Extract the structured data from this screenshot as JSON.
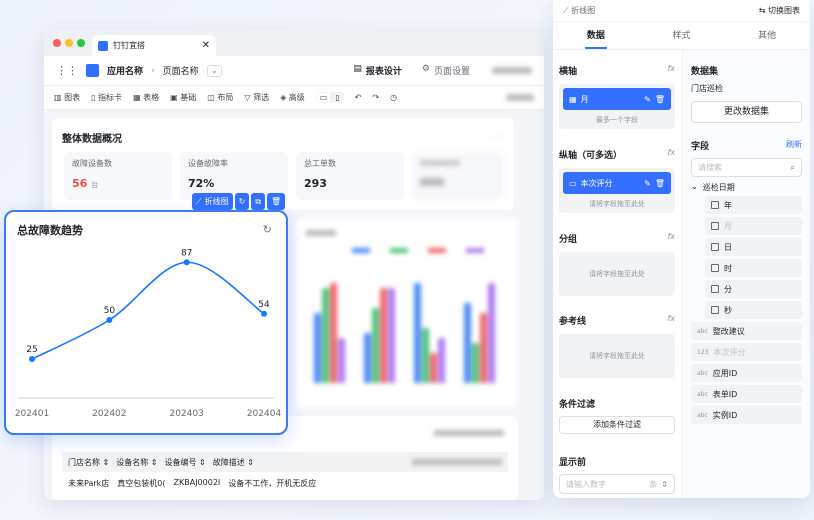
{
  "browser_tab": {
    "title": "钉钉宜搭"
  },
  "header": {
    "app_name": "应用名称",
    "page_name": "页面名称",
    "design_tab": "报表设计",
    "page_settings": "页面设置"
  },
  "toolbar": [
    "图表",
    "指标卡",
    "表格",
    "基础",
    "布局",
    "筛选",
    "高级"
  ],
  "overview": {
    "title": "整体数据概况",
    "stats": [
      {
        "label": "故障设备数",
        "value": "56",
        "unit": "台"
      },
      {
        "label": "设备故障率",
        "value": "72%"
      },
      {
        "label": "总工单数",
        "value": "293"
      }
    ]
  },
  "chart_toolbar": {
    "label": "折线图"
  },
  "chart_data": {
    "type": "line",
    "title": "总故障数趋势",
    "x": [
      "202401",
      "202402",
      "202403",
      "202404"
    ],
    "series": [
      {
        "values": [
          25,
          50,
          87,
          54
        ]
      }
    ],
    "ylim": [
      0,
      100
    ],
    "smooth": true,
    "grid": false,
    "colors": {
      "line": "#1677ff"
    }
  },
  "table": {
    "headers": [
      "门店名称",
      "设备名称",
      "设备编号",
      "故障描述"
    ],
    "row": [
      "未来Park店",
      "真空包装机0(",
      "ZKBAJ0002I",
      "设备不工作，开机无反应"
    ]
  },
  "panel": {
    "chart_type": "折线图",
    "switch_chart": "切换图表",
    "tabs": [
      "数据",
      "样式",
      "其他"
    ],
    "x_axis": {
      "title": "横轴",
      "chip": "月",
      "hint": "最多一个字段"
    },
    "y_axis": {
      "title": "纵轴（可多选）",
      "chip": "本次评分",
      "hint": "请将字段拖至此处"
    },
    "group": {
      "title": "分组",
      "hint": "请将字段拖至此处"
    },
    "reference": {
      "title": "参考线",
      "hint": "请将字段拖至此处"
    },
    "filter": {
      "title": "条件过滤",
      "button": "添加条件过滤"
    },
    "top_n": {
      "title": "显示前",
      "placeholder": "请输入数字",
      "unit": "条"
    },
    "fx": "fx",
    "dataset": {
      "title": "数据集",
      "name": "门店巡检",
      "button": "更改数据集"
    },
    "fields": {
      "title": "字段",
      "refresh": "刷新",
      "search_placeholder": "请搜索",
      "date_group": "巡检日期",
      "date_items": [
        "年",
        "月",
        "日",
        "时",
        "分",
        "秒"
      ],
      "other_items": [
        {
          "type": "abc",
          "label": "整改建议"
        },
        {
          "type": "123",
          "label": "本次评分"
        },
        {
          "type": "abc",
          "label": "应用ID"
        },
        {
          "type": "abc",
          "label": "表单ID"
        },
        {
          "type": "abc",
          "label": "实例ID"
        }
      ]
    }
  }
}
